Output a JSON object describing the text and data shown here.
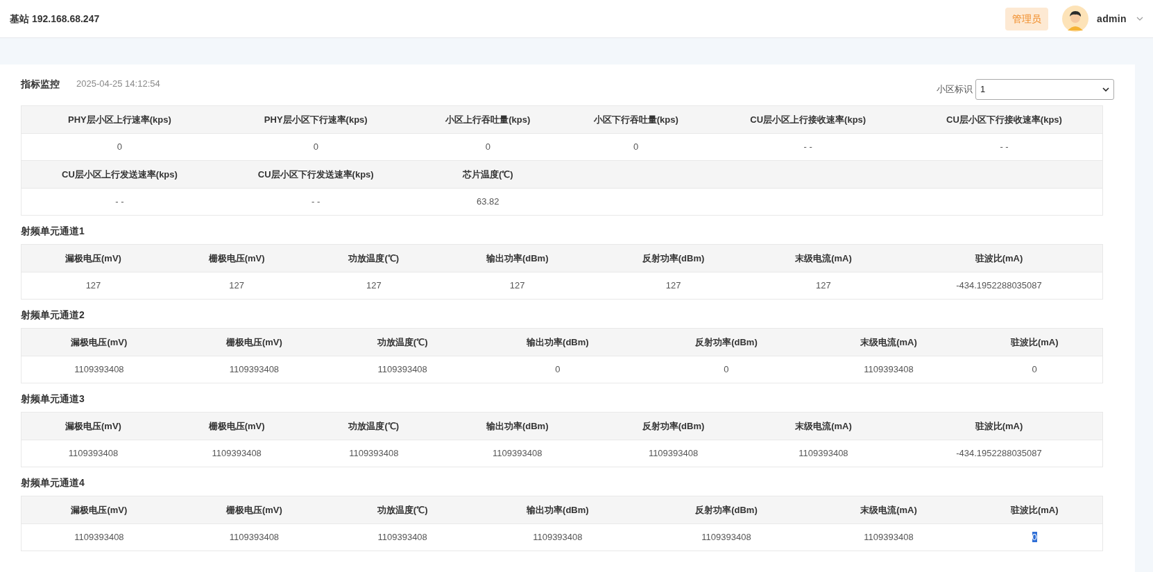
{
  "header": {
    "title": "基站 192.168.68.247",
    "role_badge": "管理员",
    "username": "admin"
  },
  "panel": {
    "title": "指标监控",
    "timestamp": "2025-04-25 14:12:54",
    "cell_select": {
      "label": "小区标识",
      "value": "1"
    }
  },
  "summary_table": {
    "groups": [
      {
        "headers": [
          "PHY层小区上行速率(kps)",
          "PHY层小区下行速率(kps)",
          "小区上行吞吐量(kps)",
          "小区下行吞吐量(kps)",
          "CU层小区上行接收速率(kps)",
          "CU层小区下行接收速率(kps)"
        ],
        "values": [
          "0",
          "0",
          "0",
          "0",
          "- -",
          "- -"
        ]
      },
      {
        "headers": [
          "CU层小区上行发送速率(kps)",
          "CU层小区下行发送速率(kps)",
          "芯片温度(℃)"
        ],
        "values": [
          "- -",
          "- -",
          "63.82"
        ]
      }
    ]
  },
  "channels": [
    {
      "title": "射频单元通道1",
      "headers": [
        "漏极电压(mV)",
        "栅极电压(mV)",
        "功放温度(℃)",
        "输出功率(dBm)",
        "反射功率(dBm)",
        "末级电流(mA)",
        "驻波比(mA)"
      ],
      "cells": [
        {
          "text": "127",
          "selected": false
        },
        {
          "text": "127",
          "selected": false
        },
        {
          "text": "127",
          "selected": false
        },
        {
          "text": "127",
          "selected": false
        },
        {
          "text": "127",
          "selected": false
        },
        {
          "text": "127",
          "selected": false
        },
        {
          "text": "-434.1952288035087",
          "selected": false
        }
      ]
    },
    {
      "title": "射频单元通道2",
      "headers": [
        "漏极电压(mV)",
        "栅极电压(mV)",
        "功放温度(℃)",
        "输出功率(dBm)",
        "反射功率(dBm)",
        "末级电流(mA)",
        "驻波比(mA)"
      ],
      "cells": [
        {
          "text": "1109393408",
          "selected": false
        },
        {
          "text": "1109393408",
          "selected": false
        },
        {
          "text": "1109393408",
          "selected": false
        },
        {
          "text": "0",
          "selected": false
        },
        {
          "text": "0",
          "selected": false
        },
        {
          "text": "1109393408",
          "selected": false
        },
        {
          "text": "0",
          "selected": false
        }
      ]
    },
    {
      "title": "射频单元通道3",
      "headers": [
        "漏极电压(mV)",
        "栅极电压(mV)",
        "功放温度(℃)",
        "输出功率(dBm)",
        "反射功率(dBm)",
        "末级电流(mA)",
        "驻波比(mA)"
      ],
      "cells": [
        {
          "text": "1109393408",
          "selected": false
        },
        {
          "text": "1109393408",
          "selected": false
        },
        {
          "text": "1109393408",
          "selected": false
        },
        {
          "text": "1109393408",
          "selected": false
        },
        {
          "text": "1109393408",
          "selected": false
        },
        {
          "text": "1109393408",
          "selected": false
        },
        {
          "text": "-434.1952288035087",
          "selected": false
        }
      ]
    },
    {
      "title": "射频单元通道4",
      "headers": [
        "漏极电压(mV)",
        "栅极电压(mV)",
        "功放温度(℃)",
        "输出功率(dBm)",
        "反射功率(dBm)",
        "末级电流(mA)",
        "驻波比(mA)"
      ],
      "cells": [
        {
          "text": "1109393408",
          "selected": false
        },
        {
          "text": "1109393408",
          "selected": false
        },
        {
          "text": "1109393408",
          "selected": false
        },
        {
          "text": "1109393408",
          "selected": false
        },
        {
          "text": "1109393408",
          "selected": false
        },
        {
          "text": "1109393408",
          "selected": false
        },
        {
          "text": "0",
          "selected": true
        }
      ]
    }
  ]
}
